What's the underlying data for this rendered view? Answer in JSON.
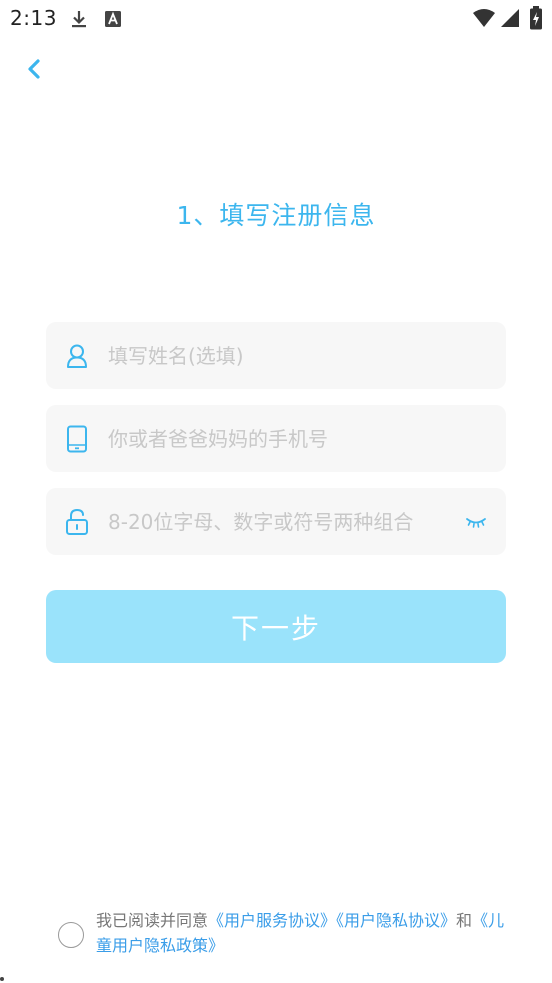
{
  "status_bar": {
    "time": "2:13",
    "icons": [
      "download-icon",
      "font-a-icon",
      "wifi-icon",
      "signal-icon",
      "battery-charging-icon"
    ]
  },
  "header": {
    "back_icon": "chevron-left-icon"
  },
  "title": "1、填写注册信息",
  "form": {
    "name_placeholder": "填写姓名(选填)",
    "phone_placeholder": "你或者爸爸妈妈的手机号",
    "password_placeholder": "8-20位字母、数字或符号两种组合",
    "name_icon": "user-icon",
    "phone_icon": "phone-icon",
    "password_icon": "unlock-icon",
    "eye_icon": "eye-closed-icon"
  },
  "next_button": "下一步",
  "agreement": {
    "prefix": "我已阅读并同意",
    "link_service": "《用户服务协议》",
    "link_privacy": "《用户隐私协议》",
    "conjunction": "和",
    "link_children": "《儿童用户隐私政策》"
  },
  "colors": {
    "accent": "#3cb6ee",
    "button": "#9ae3fb",
    "field_bg": "#f7f7f7",
    "link": "#3a9de8",
    "placeholder": "#c8c8c8"
  }
}
